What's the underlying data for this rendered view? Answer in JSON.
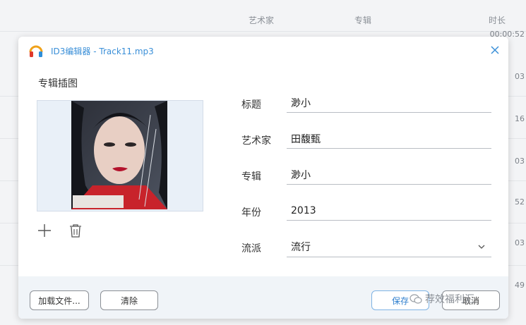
{
  "background_list": {
    "columns": {
      "artist": "艺术家",
      "album": "专辑",
      "duration": "时长"
    },
    "durations": [
      "00:00:52",
      "03",
      "16",
      "03",
      "52",
      "03",
      "49"
    ]
  },
  "dialog": {
    "title": "ID3编辑器 - Track11.mp3",
    "album_art_label": "专辑插图",
    "fields": {
      "title_label": "标题",
      "title_value": "渺小",
      "artist_label": "艺术家",
      "artist_value": "田馥甄",
      "album_label": "专辑",
      "album_value": "渺小",
      "year_label": "年份",
      "year_value": "2013",
      "genre_label": "流派",
      "genre_value": "流行"
    },
    "buttons": {
      "load_file": "加载文件...",
      "clear": "清除",
      "save": "保存",
      "cancel": "取消"
    }
  },
  "watermark": "荐效福利汇",
  "colors": {
    "accent": "#3a8fd8",
    "footer_bg": "#f0f4f8",
    "cover_red": "#c8232b"
  },
  "icons": [
    "app-headphone-icon",
    "close-icon",
    "add-icon",
    "trash-icon",
    "chevron-down-icon"
  ]
}
